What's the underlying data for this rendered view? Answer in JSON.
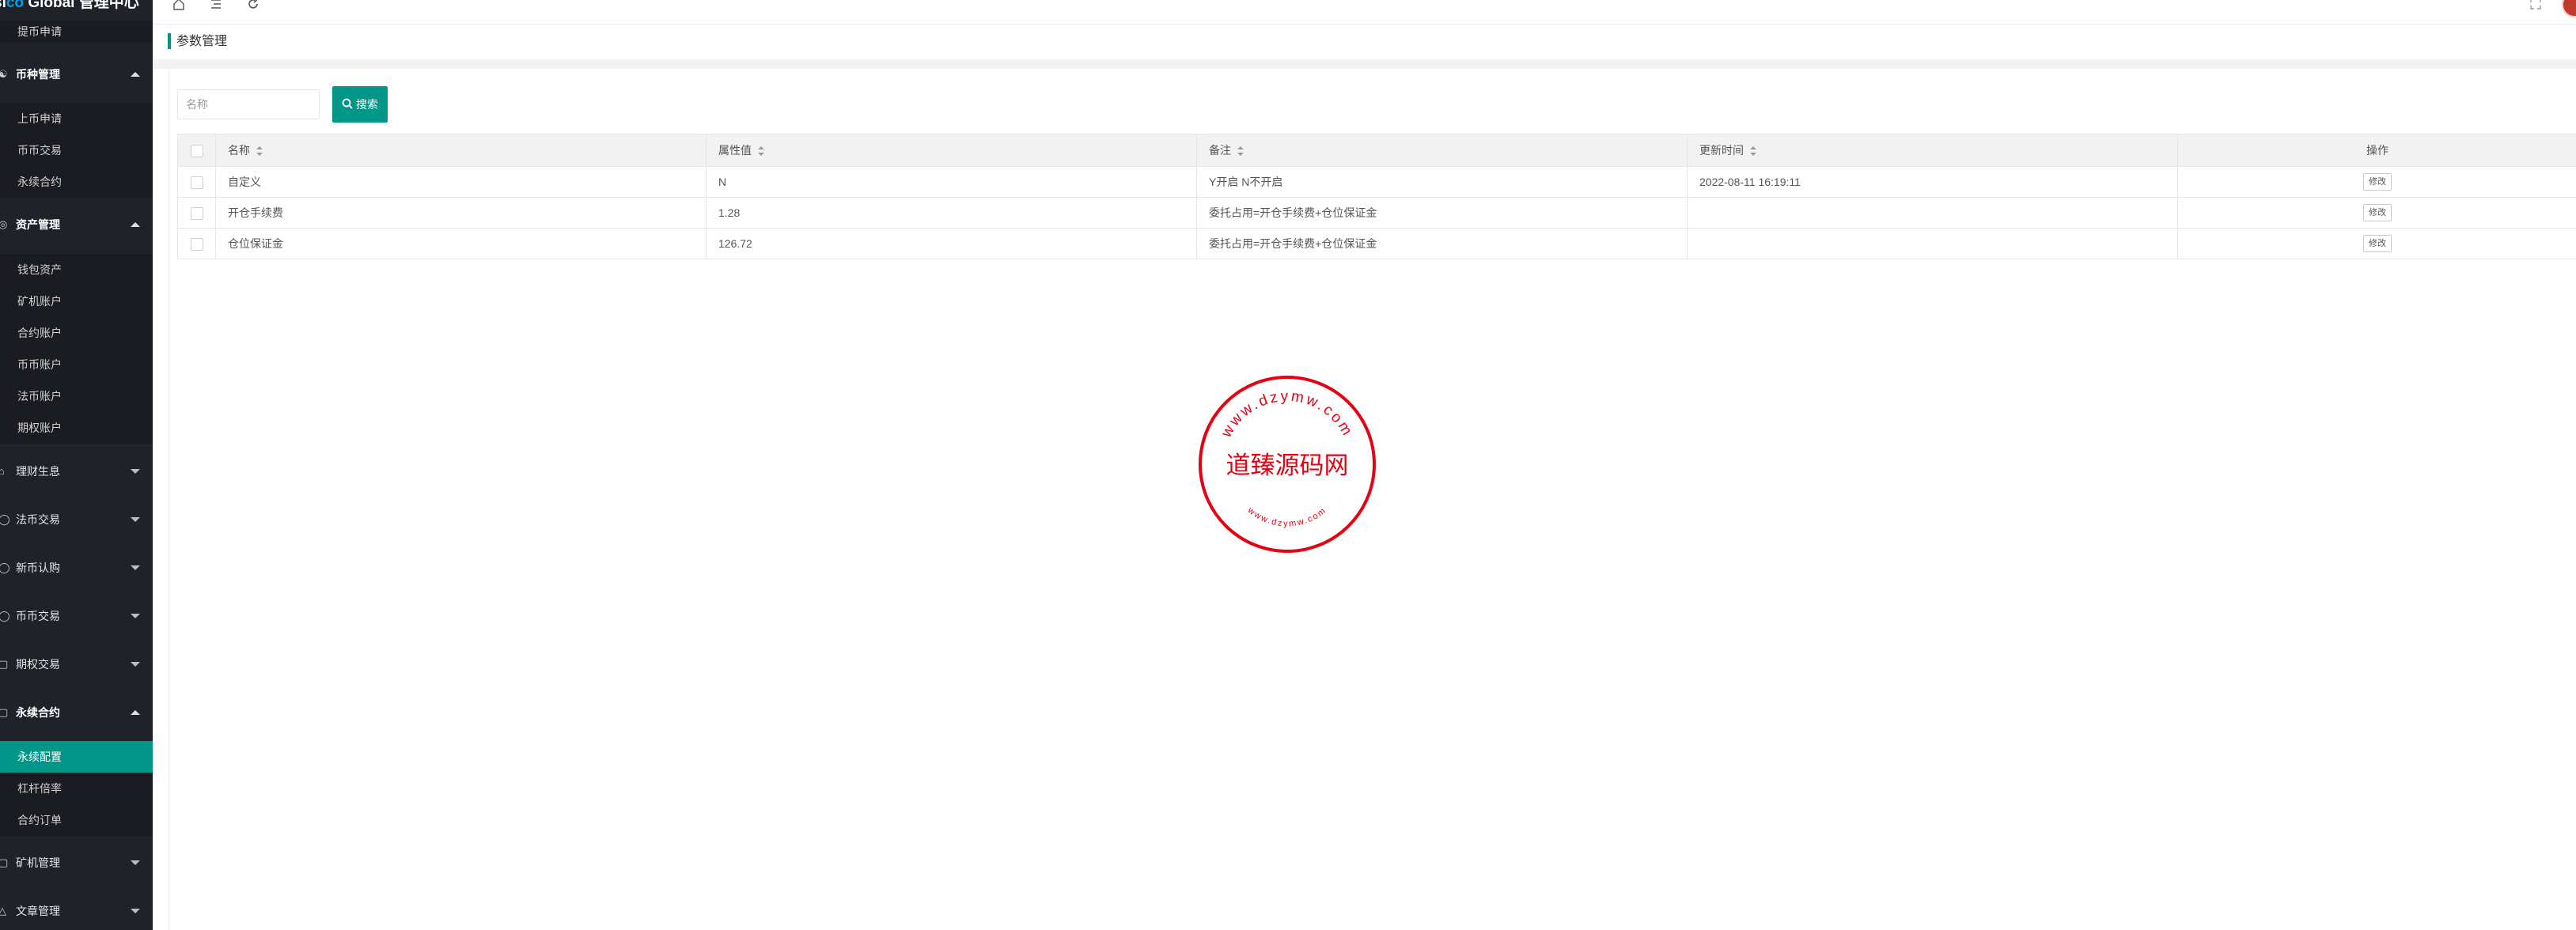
{
  "app": {
    "brand_prefix": "si",
    "brand_highlight": "co",
    "brand_rest": " Global 管理中心"
  },
  "sidebar": {
    "top_item": "提币申请",
    "groups": [
      {
        "label": "币种管理",
        "icon": "coin-icon",
        "open": true,
        "items": [
          "上币申请",
          "币币交易",
          "永续合约"
        ]
      },
      {
        "label": "资产管理",
        "icon": "asset-icon",
        "open": true,
        "items": [
          "钱包资产",
          "矿机账户",
          "合约账户",
          "币币账户",
          "法币账户",
          "期权账户"
        ]
      },
      {
        "label": "理财生息",
        "icon": "finance-icon",
        "open": false,
        "items": []
      },
      {
        "label": "法币交易",
        "icon": "fiat-icon",
        "open": false,
        "items": []
      },
      {
        "label": "新币认购",
        "icon": "subscribe-icon",
        "open": false,
        "items": []
      },
      {
        "label": "币币交易",
        "icon": "exchange-icon",
        "open": false,
        "items": []
      },
      {
        "label": "期权交易",
        "icon": "option-icon",
        "open": false,
        "items": []
      },
      {
        "label": "永续合约",
        "icon": "contract-icon",
        "open": true,
        "items": [
          "永续配置",
          "杠杆倍率",
          "合约订单"
        ],
        "active_item": "永续配置"
      },
      {
        "label": "矿机管理",
        "icon": "miner-icon",
        "open": false,
        "items": []
      },
      {
        "label": "文章管理",
        "icon": "article-icon",
        "open": false,
        "items": []
      }
    ]
  },
  "breadcrumb": {
    "title": "参数管理"
  },
  "search": {
    "placeholder": "名称",
    "value": "",
    "button_label": "搜索"
  },
  "table": {
    "columns": [
      "名称",
      "属性值",
      "备注",
      "更新时间",
      "操作"
    ],
    "rows": [
      {
        "name": "自定义",
        "value": "N",
        "remark": "Y开启 N不开启",
        "updated": "2022-08-11 16:19:11",
        "action": "修改"
      },
      {
        "name": "开仓手续费",
        "value": "1.28",
        "remark": "委托占用=开仓手续费+仓位保证金",
        "updated": "",
        "action": "修改"
      },
      {
        "name": "仓位保证金",
        "value": "126.72",
        "remark": "委托占用=开仓手续费+仓位保证金",
        "updated": "",
        "action": "修改"
      }
    ]
  },
  "watermark": {
    "center_text": "道臻源码网",
    "ring_text_top": "www.dzymw.com",
    "ring_text_bottom": "www.dzymw.com",
    "color": "#e60012"
  },
  "colors": {
    "accent": "#009688",
    "sidebar_bg": "#20222a",
    "header_bg": "#f2f2f2"
  }
}
